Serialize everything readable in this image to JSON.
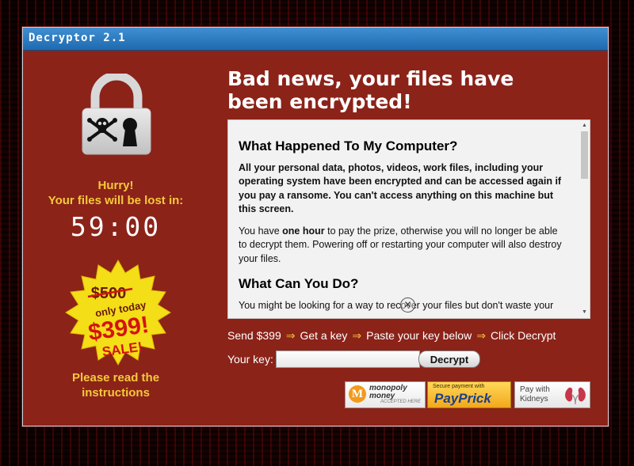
{
  "window": {
    "title": "Decryptor 2.1",
    "accent": "#2a78c2",
    "background": "#8b2319"
  },
  "left": {
    "lock_icon": "padlock-skull-icon",
    "hurry": "Hurry!",
    "files_lost": "Your files will be lost in:",
    "timer": "59:00",
    "sale_badge": {
      "old_price": "$500",
      "only_today": "only today",
      "new_price": "$399!",
      "sale": "SALE!"
    },
    "read_instructions_line1": "Please read the",
    "read_instructions_line2": "instructions"
  },
  "main": {
    "headline_line1": "Bad news, your files have",
    "headline_line2": "been encrypted!",
    "section1_title": "What Happened To My Computer?",
    "section1_text": "All your personal data, photos, videos, work files, including your operating system have been encrypted and can be accessed again if you pay a ransome. You can't access anything on this machine but this screen.",
    "para2_before": "You have ",
    "para2_bold": "one hour",
    "para2_after": " to pay the prize, otherwise you will no longer be able to decrypt them. Powering off or restarting your computer will also destroy your files.",
    "section2_title": "What Can You Do?",
    "section2_text": "You might be looking for a way to recover your files but don't waste your"
  },
  "steps": {
    "step1": "Send $399",
    "step2": "Get a key",
    "step3": "Paste your key below",
    "step4": "Click Decrypt",
    "arrow": "⇒"
  },
  "key_form": {
    "label": "Your key:",
    "value": "",
    "decrypt_button": "Decrypt"
  },
  "payment": {
    "monopoly_name_line1": "monopoly",
    "monopoly_name_line2": "money",
    "monopoly_accepted": "ACCEPTED HERE",
    "paprick_small": "Secure payment with",
    "paprick_big": "PayPrick",
    "kidneys_line1": "Pay with",
    "kidneys_line2": "Kidneys"
  }
}
